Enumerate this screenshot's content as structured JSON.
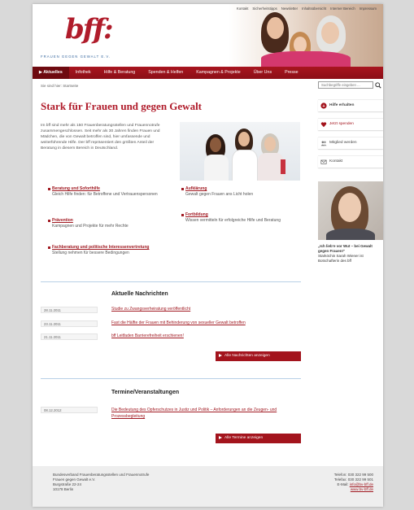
{
  "top_nav": [
    "Kontakt",
    "Sicherheitstipps",
    "Newsletter",
    "Inhaltsübersicht",
    "Interner Bereich",
    "Impressum"
  ],
  "logo": {
    "text": "bff:",
    "tagline": "FRAUEN GEGEN GEWALT E.V."
  },
  "main_nav": [
    {
      "label": "Aktuelles",
      "active": true
    },
    {
      "label": "Infothek",
      "active": false
    },
    {
      "label": "Hilfe & Beratung",
      "active": false
    },
    {
      "label": "Spenden & Helfen",
      "active": false
    },
    {
      "label": "Kampagnen & Projekte",
      "active": false
    },
    {
      "label": "Über Uns",
      "active": false
    },
    {
      "label": "Presse",
      "active": false
    }
  ],
  "breadcrumb": "Sie sind hier: Startseite",
  "search": {
    "placeholder": "Suchbegriffe eingeben ..."
  },
  "page_title": "Stark für Frauen und gegen Gewalt",
  "intro_text": "Im bff sind mehr als 150 Frauenberatungsstellen und Frauennotrufe zusammengeschlossen. Seit mehr als 30 Jahren finden Frauen und Mädchen, die von Gewalt betroffen sind, hier umfassende und weiterführende Hilfe. Der bff repräsentiert den größten Anteil der Beratung in diesem Bereich in Deutschland.",
  "features": [
    {
      "title": "Beratung und Soforthilfe",
      "text": "Gleich Hilfe finden: für Betroffene und Vertrauenspersonen"
    },
    {
      "title": "Prävention",
      "text": "Kampagnen und Projekte für mehr Rechte"
    },
    {
      "title": "Fachberatung und politische Interessenvertretung",
      "text": "Stellung nehmen für bessere Bedingungen"
    },
    {
      "title": "Aufklärung",
      "text": "Gewalt gegen Frauen ans Licht holen"
    },
    {
      "title": "Fortbildung",
      "text": "Wissen vermitteln für erfolgreiche Hilfe und Beratung"
    }
  ],
  "news": {
    "title": "Aktuelle Nachrichten",
    "items": [
      {
        "date": "28.11.2011",
        "text": "Studie zu Zwangsverheiratung veröffentlicht"
      },
      {
        "date": "23.11.2011",
        "text": "Fast die Hälfte der Frauen mit Behinderung von sexueller Gewalt betroffen"
      },
      {
        "date": "21.11.2011",
        "text": "bff Leitfaden Barrierefreiheit erschienen!"
      }
    ],
    "button": "Alle Nachrichten anzeigen"
  },
  "events": {
    "title": "Termine/Veranstaltungen",
    "items": [
      {
        "date": "08.12.2012",
        "text": "Die Bedeutung des Opferschutzes in Justiz und Politik – Anforderungen an die Zeugen- und Prozessbegleitung"
      }
    ],
    "button": "Alle Termine anzeigen"
  },
  "sidebar": [
    {
      "label": "Hilfe erhalten",
      "icon": "help-icon",
      "bold": true
    },
    {
      "label": "Jetzt spenden",
      "icon": "donate-icon",
      "bold": false
    },
    {
      "label": "Mitglied werden",
      "icon": "members-icon",
      "bold": false
    },
    {
      "label": "Kontakt",
      "icon": "contact-icon",
      "bold": false
    }
  ],
  "side_quote": {
    "title": "„Ich lieb‘e vor Wut – bei Gewalt gegen Frauen!“",
    "text": "Starköchin Sarah Wiener ist Botschafterin des bff"
  },
  "footer": {
    "address": [
      "Bundesverband Frauenberatungsstellen und Frauennotrufe",
      "Frauen gegen Gewalt e.V.",
      "Burgstraße 22-24",
      "10178 Berlin"
    ],
    "phone": "Telefon: 030 322 99 500",
    "fax": "Telefax: 030 322 99 501",
    "email_label": "E-Mail:",
    "email": "info@bv-bff.de",
    "website": "www.bv-bff.de"
  },
  "colors": {
    "brand_red": "#b01c2b",
    "nav_red": "#9d131c",
    "accent_blue": "#3a6aa0"
  }
}
